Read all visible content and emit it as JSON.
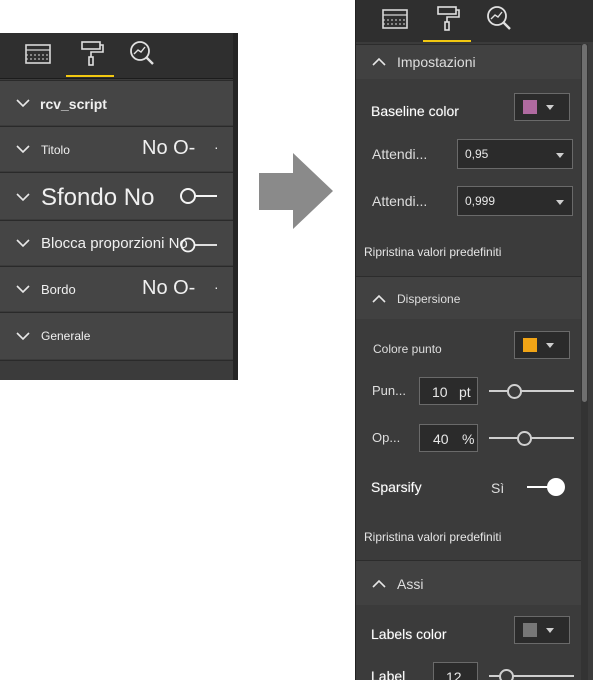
{
  "left": {
    "tabs": [
      {
        "name": "fields-tab",
        "icon": "fields-icon"
      },
      {
        "name": "format-tab",
        "icon": "paint-roller-icon"
      },
      {
        "name": "analytics-tab",
        "icon": "analytics-icon"
      }
    ],
    "rows": {
      "visual_title": "rcv_script",
      "titolo": "Titolo",
      "titolo_value": "No O-",
      "sfondo": "Sfondo No",
      "blocca": "Blocca proporzioni No",
      "bordo": "Bordo",
      "bordo_value": "No O-",
      "generale": "Generale",
      "dot": "·"
    }
  },
  "right": {
    "impostazioni": {
      "header": "Impostazioni",
      "baseline_label": "Baseline color",
      "baseline_color": "#b06aa0",
      "attendi1_label": "Attendi...",
      "attendi1_value": "0,95",
      "attendi2_label": "Attendi...",
      "attendi2_value": "0,999",
      "reset": "Ripristina valori predefiniti"
    },
    "dispersione": {
      "header": "Dispersione",
      "colore_label": "Colore punto",
      "colore_color": "#f2a516",
      "pun_label": "Pun...",
      "pun_value": "10",
      "pun_unit": "pt",
      "pun_level": 0.26,
      "op_label": "Op...",
      "op_value": "40",
      "op_unit": "%",
      "op_level": 0.4,
      "sparsify_label": "Sparsify",
      "sparsify_value": "Sì",
      "reset": "Ripristina valori predefiniti"
    },
    "assi": {
      "header": "Assi",
      "labels_color_label": "Labels color",
      "labels_color": "#777777",
      "label_label": "Label",
      "label_value": "12"
    }
  },
  "colors": {
    "accent": "#f2c811",
    "panel": "#3b3b3b"
  }
}
